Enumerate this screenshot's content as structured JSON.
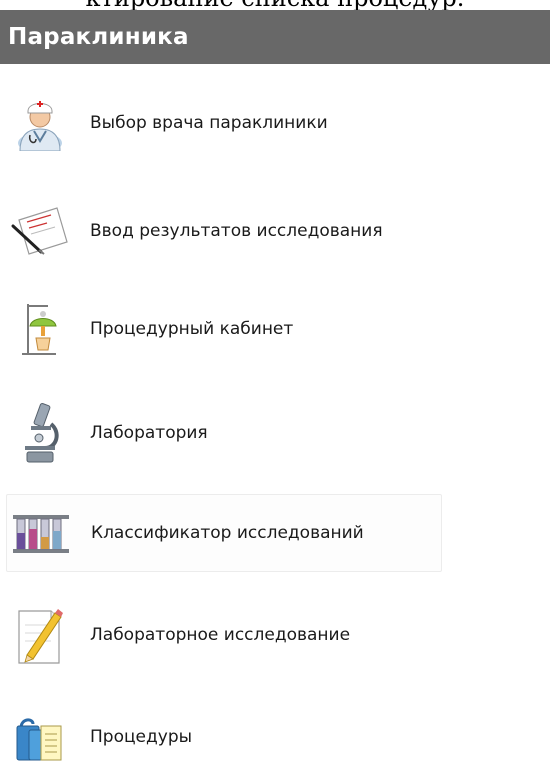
{
  "top_caption": "ктирование списка процедур.",
  "header": {
    "title": "Параклиника"
  },
  "menu": {
    "items": [
      {
        "label": "Выбор врача параклиники",
        "icon": "doctor-icon"
      },
      {
        "label": "Ввод результатов исследования",
        "icon": "document-pen-icon"
      },
      {
        "label": "Процедурный кабинет",
        "icon": "iv-drip-icon"
      },
      {
        "label": "Лаборатория",
        "icon": "microscope-icon"
      },
      {
        "label": "Классификатор исследований",
        "icon": "test-tubes-icon"
      },
      {
        "label": "Лабораторное исследование",
        "icon": "pencil-note-icon"
      },
      {
        "label": "Процедуры",
        "icon": "folders-icon"
      }
    ]
  }
}
